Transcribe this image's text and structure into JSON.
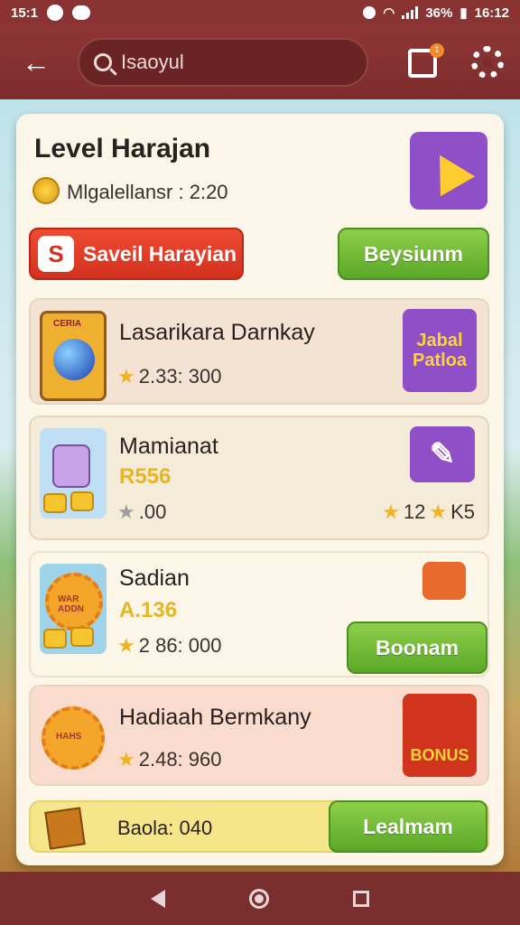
{
  "status_bar": {
    "time_left": "15:1",
    "battery_text": "36%",
    "time_right": "16:12"
  },
  "app_bar": {
    "search_text": "Isaoyul",
    "notification_count": "1",
    "icons": [
      "back-arrow-icon",
      "search-icon",
      "notification-icon",
      "gear-icon"
    ]
  },
  "card": {
    "title": "Level Harajan",
    "subtitle": "Mlgalellansr : 2:20",
    "red_button_label": "Saveil Harayian",
    "red_button_badge": "S",
    "green_button_label": "Beysiunm"
  },
  "rows": [
    {
      "name": "Lasarikara Darnkay",
      "meta": "2.33: 300",
      "thumb_label": "CERIA",
      "right_icon_text": "Jabal Patloa"
    },
    {
      "name": "Mamianat",
      "price": "R556",
      "meta": ".00",
      "rating_text": "12",
      "rating_value": "K5"
    },
    {
      "name": "Sadian",
      "price": "A.136",
      "meta": "2 86: 000",
      "thumb_label": "WAR ADDN",
      "button_label": "Boonam"
    },
    {
      "name": "Hadiaah Bermkany",
      "meta": "2.48: 960",
      "thumb_label": "HAHS",
      "right_icon_text": "BONUS"
    }
  ],
  "footer_row": {
    "balance": "Baola: 040",
    "button_label": "Lealmam"
  },
  "colors": {
    "app_bar": "#8f3636",
    "card_bg": "#fbf6e7",
    "accent_green": "#5ba828",
    "accent_red": "#d3311f",
    "accent_purple": "#8e4fc7",
    "gold": "#e6b52a"
  }
}
